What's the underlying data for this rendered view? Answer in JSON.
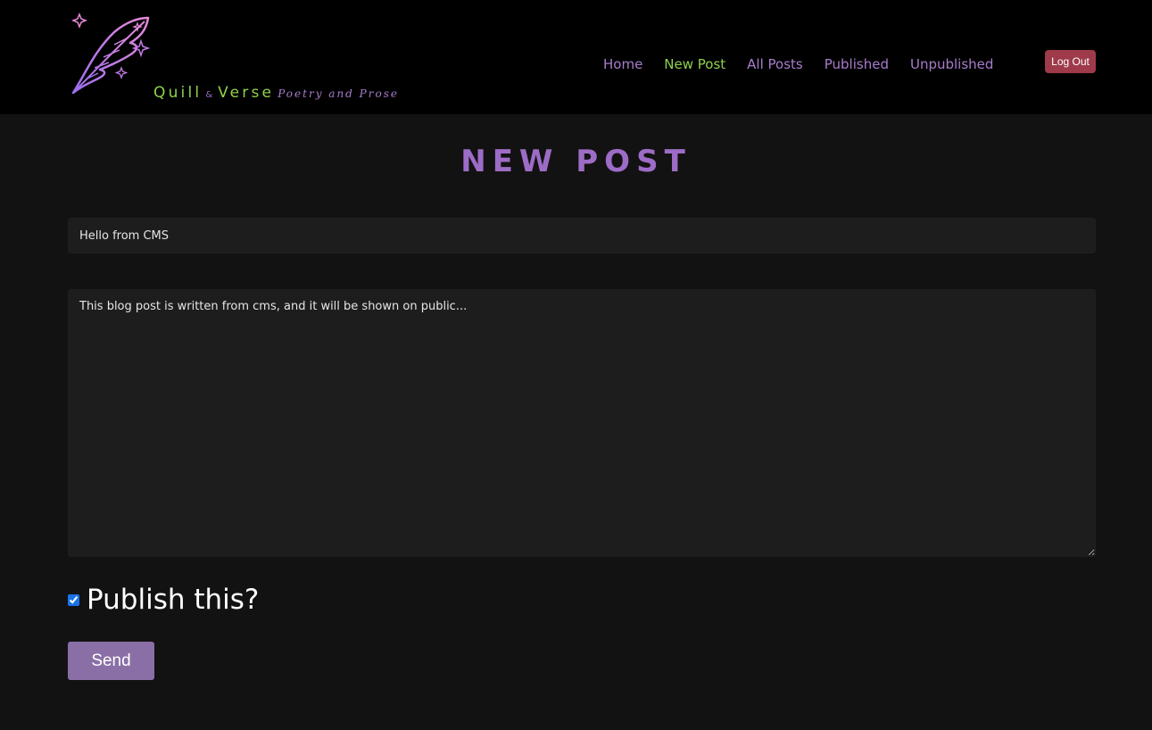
{
  "brand": {
    "name_part1": "Quill",
    "ampersand": "&",
    "name_part2": "Verse",
    "tagline": "Poetry and Prose",
    "logo_icon": "feather-quill-icon"
  },
  "nav": {
    "items": [
      {
        "label": "Home",
        "active": false
      },
      {
        "label": "New Post",
        "active": true
      },
      {
        "label": "All Posts",
        "active": false
      },
      {
        "label": "Published",
        "active": false
      },
      {
        "label": "Unpublished",
        "active": false
      }
    ],
    "logout_label": "Log Out"
  },
  "page": {
    "title": "NEW POST"
  },
  "form": {
    "title_value": "Hello from CMS",
    "body_value": "This blog post is written from cms, and it will be shown on public...",
    "publish_label": "Publish this?",
    "publish_checked": true,
    "send_label": "Send"
  },
  "colors": {
    "background": "#121212",
    "header_bg": "#000000",
    "accent_purple": "#9d6cc6",
    "accent_green": "#8fd14f",
    "logout_bg": "#9e3a4a",
    "send_bg": "#8a6fa6"
  }
}
